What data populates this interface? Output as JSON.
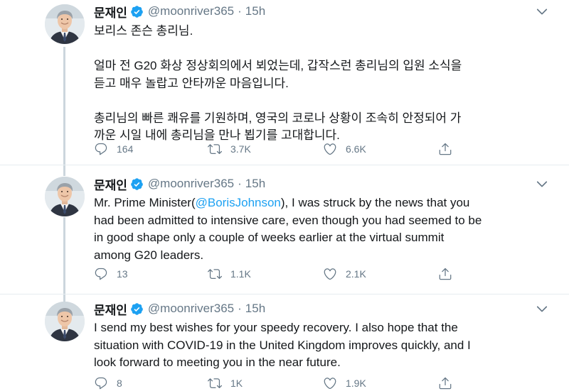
{
  "colors": {
    "text": "#14171a",
    "muted": "#657786",
    "link": "#1da1f2",
    "verified": "#1da1f2",
    "thread_line": "#ccd6dd"
  },
  "icons": {
    "verified": "verified-badge-icon",
    "caret": "chevron-down-icon",
    "reply": "reply-bubble-icon",
    "retweet": "retweet-icon",
    "like": "heart-icon",
    "share": "share-upload-icon"
  },
  "tweets": [
    {
      "author": {
        "name": "문재인",
        "handle": "@moonriver365",
        "separator": "·",
        "time": "15h"
      },
      "lines": [
        "보리스 존슨 총리님.",
        "",
        "얼마 전 G20 화상 정상회의에서 뵈었는데, 갑작스런 총리님의 입원 소식을",
        "듣고 매우 놀랍고 안타까운 마음입니다.",
        "",
        "총리님의 빠른 쾌유를 기원하며, 영국의 코로나 상황이 조속히 안정되어 가",
        "까운 시일 내에 총리님을 만나 뵙기를 고대합니다."
      ],
      "stats": {
        "replies": "164",
        "retweets": "3.7K",
        "likes": "6.6K"
      }
    },
    {
      "author": {
        "name": "문재인",
        "handle": "@moonriver365",
        "separator": "·",
        "time": "15h"
      },
      "line1_prefix": "Mr. Prime Minister(",
      "line1_mention": "@BorisJohnson",
      "line1_suffix": "), I was struck by the news that you",
      "lines": [
        "had been admitted to intensive care, even though you had seemed to be",
        "in good shape only a couple of weeks earlier at the virtual summit",
        "among G20 leaders."
      ],
      "stats": {
        "replies": "13",
        "retweets": "1.1K",
        "likes": "2.1K"
      }
    },
    {
      "author": {
        "name": "문재인",
        "handle": "@moonriver365",
        "separator": "·",
        "time": "15h"
      },
      "lines": [
        "I send my best wishes for your speedy recovery. I also hope that the",
        "situation with COVID-19 in the United Kingdom improves quickly, and I",
        "look forward to meeting you in the near future."
      ],
      "stats": {
        "replies": "8",
        "retweets": "1K",
        "likes": "1.9K"
      }
    }
  ]
}
